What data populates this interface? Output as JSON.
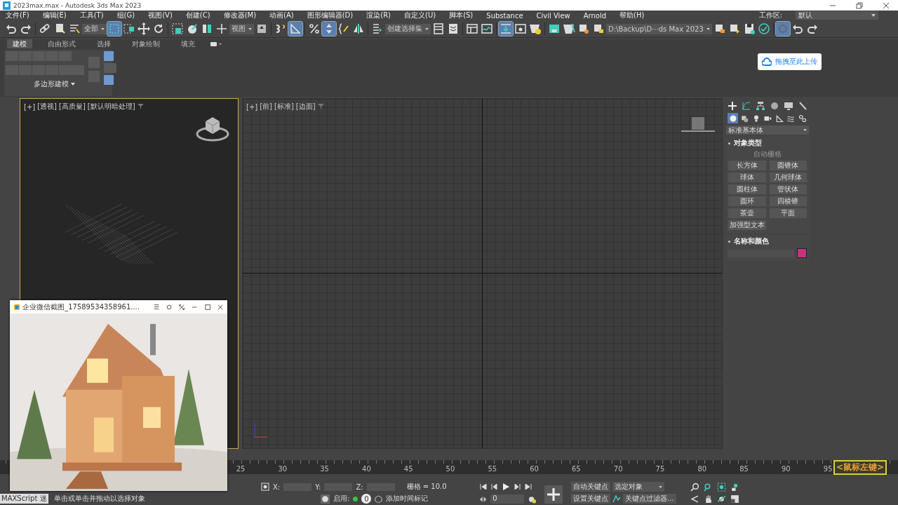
{
  "window": {
    "title": "2023max.max - Autodesk 3ds Max 2023"
  },
  "menu": [
    "文件(F)",
    "编辑(E)",
    "工具(T)",
    "组(G)",
    "视图(V)",
    "创建(C)",
    "修改器(M)",
    "动画(A)",
    "图形编辑器(D)",
    "渲染(R)",
    "自定义(U)",
    "脚本(S)",
    "Substance",
    "Civil View",
    "Arnold",
    "帮助(H)"
  ],
  "workspace": {
    "label": "工作区:",
    "value": "默认"
  },
  "toolbar": [
    {
      "kind": "button",
      "selected": false
    },
    {
      "kind": "button",
      "selected": false
    },
    {
      "kind": "sep"
    },
    {
      "kind": "button",
      "selected": false
    },
    {
      "kind": "button",
      "selected": false
    },
    {
      "kind": "button",
      "selected": false
    },
    {
      "kind": "dropdown",
      "value": "全部"
    },
    {
      "kind": "button",
      "selected": true
    },
    {
      "kind": "button",
      "selected": false
    },
    {
      "kind": "button",
      "selected": false
    },
    {
      "kind": "button",
      "selected": false
    },
    {
      "kind": "sep"
    },
    {
      "kind": "button",
      "selected": false
    },
    {
      "kind": "button",
      "selected": false
    },
    {
      "kind": "button",
      "selected": false
    },
    {
      "kind": "button",
      "selected": false
    },
    {
      "kind": "dropdown",
      "value": "视图"
    },
    {
      "kind": "button",
      "selected": false
    },
    {
      "kind": "sep"
    },
    {
      "kind": "button",
      "selected": false
    },
    {
      "kind": "button",
      "selected": true
    },
    {
      "kind": "sep"
    },
    {
      "kind": "button",
      "selected": false
    },
    {
      "kind": "button",
      "selected": true
    },
    {
      "kind": "button",
      "selected": false
    },
    {
      "kind": "button",
      "selected": false
    },
    {
      "kind": "sep"
    },
    {
      "kind": "button",
      "selected": false
    },
    {
      "kind": "dropdown",
      "value": "创建选择集"
    },
    {
      "kind": "button",
      "selected": false
    },
    {
      "kind": "button",
      "selected": false
    },
    {
      "kind": "sep"
    },
    {
      "kind": "button",
      "selected": false
    },
    {
      "kind": "button",
      "selected": false
    },
    {
      "kind": "sep"
    },
    {
      "kind": "button",
      "selected": true
    },
    {
      "kind": "button",
      "selected": false
    },
    {
      "kind": "button",
      "selected": false
    },
    {
      "kind": "sep"
    },
    {
      "kind": "button",
      "selected": false
    },
    {
      "kind": "button",
      "selected": false
    },
    {
      "kind": "button",
      "selected": false
    },
    {
      "kind": "button",
      "selected": false
    },
    {
      "kind": "dropdown",
      "value": "D:\\Backup\\D···ds Max 2023"
    },
    {
      "kind": "button",
      "selected": false
    },
    {
      "kind": "button",
      "selected": false
    },
    {
      "kind": "button",
      "selected": false
    },
    {
      "kind": "button",
      "selected": false
    },
    {
      "kind": "sep"
    },
    {
      "kind": "button",
      "selected": true
    },
    {
      "kind": "button",
      "selected": false
    },
    {
      "kind": "button",
      "selected": false
    }
  ],
  "ribbon": {
    "tabs": [
      {
        "label": "建模",
        "selected": true
      },
      {
        "label": "自由形式",
        "selected": false
      },
      {
        "label": "选择",
        "selected": false
      },
      {
        "label": "对象绘制",
        "selected": false
      },
      {
        "label": "填充",
        "selected": false
      }
    ],
    "panel_label": "多边形建模"
  },
  "upload_button": "拖拽至此上传",
  "viewports": [
    {
      "labels": [
        "[+]",
        "[透视]",
        "[高质量]",
        "[默认明暗处理]"
      ],
      "active": true
    },
    {
      "labels": [
        "[+]",
        "[前]",
        "[标准]",
        "[边面]"
      ],
      "active": false
    }
  ],
  "command_panel": {
    "category_icons": [
      {
        "selected": true
      },
      {
        "selected": false
      },
      {
        "selected": false
      },
      {
        "selected": false
      },
      {
        "selected": false
      },
      {
        "selected": false
      },
      {
        "selected": false
      }
    ],
    "dropdown": "标准基本体",
    "rollouts": [
      {
        "title": "对象类型",
        "autogrid": "自动栅格",
        "buttons": [
          "长方体",
          "圆锥体",
          "球体",
          "几何球体",
          "圆柱体",
          "管状体",
          "圆环",
          "四棱锥",
          "茶壶",
          "平面",
          "加强型文本"
        ]
      },
      {
        "title": "名称和颜色",
        "color": "#c8327c"
      }
    ]
  },
  "timeline": {
    "ticks": [
      "25",
      "30",
      "35",
      "40",
      "45",
      "50",
      "55",
      "60",
      "65",
      "70",
      "75",
      "80",
      "85",
      "90",
      "95"
    ]
  },
  "keystroke": "<鼠标左键>",
  "status": {
    "maxscript": "MAXScript 迷",
    "prompt": "单击或单击并拖动以选择对象",
    "x_label": "X:",
    "y_label": "Y:",
    "z_label": "Z:",
    "grid": "栅格 = 10.0",
    "enable_label": "启用:",
    "enable_value": "0",
    "time_tag": "添加时间标记",
    "frame": "0",
    "auto_key": "自动关键点",
    "key_mode": "选定对象",
    "set_key": "设置关键点",
    "key_filters": "关键点过滤器..."
  },
  "floating_window": {
    "title": "企业微信截图_17589534358961...."
  }
}
